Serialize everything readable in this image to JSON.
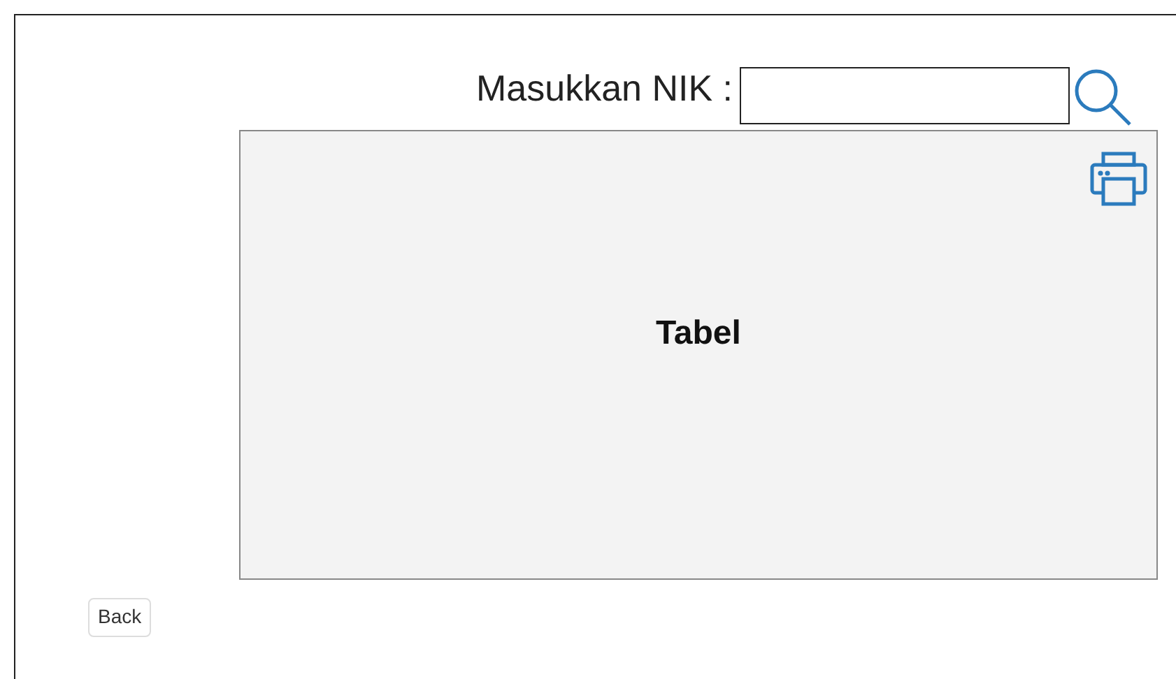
{
  "search": {
    "label": "Masukkan NIK :"
  },
  "table_panel": {
    "label": "Tabel"
  },
  "buttons": [
    {
      "label": "Back"
    }
  ]
}
